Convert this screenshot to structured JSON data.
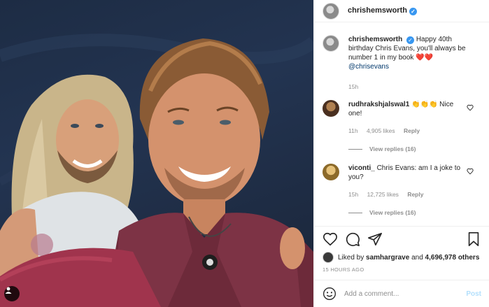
{
  "post": {
    "author": "chrishemsworth",
    "verified_mark": "✓"
  },
  "caption": {
    "user": "chrishemsworth",
    "text": "Happy 40th birthday Chris Evans, you'll always be number 1 in my book ❤️❤️",
    "mention": "@chrisevans",
    "age": "15h"
  },
  "comments": [
    {
      "user": "rudhrakshjalswal1",
      "text": "👏👏👏 Nice one!",
      "age": "11h",
      "likes": "4,905 likes",
      "reply": "Reply",
      "view_replies": "View replies (16)"
    },
    {
      "user": "viconti_",
      "text": "Chris Evans: am I a joke to you?",
      "age": "15h",
      "likes": "12,725 likes",
      "reply": "Reply",
      "view_replies": "View replies (16)"
    }
  ],
  "likes": {
    "prefix": "Liked by",
    "user": "samhargrave",
    "and": "and",
    "others": "4,696,978 others"
  },
  "timestamp": "15 HOURS AGO",
  "add_comment": {
    "placeholder": "Add a comment...",
    "post_label": "Post"
  },
  "icons": {
    "like": "heart-icon",
    "comment": "comment-icon",
    "share": "paper-plane-icon",
    "save": "bookmark-icon",
    "emoji": "smiley-icon",
    "tag": "user-tag-icon"
  },
  "colors": {
    "link": "#00376b",
    "verified": "#3897f0",
    "muted": "#8e8e8e",
    "post_button": "#b2dffc"
  }
}
